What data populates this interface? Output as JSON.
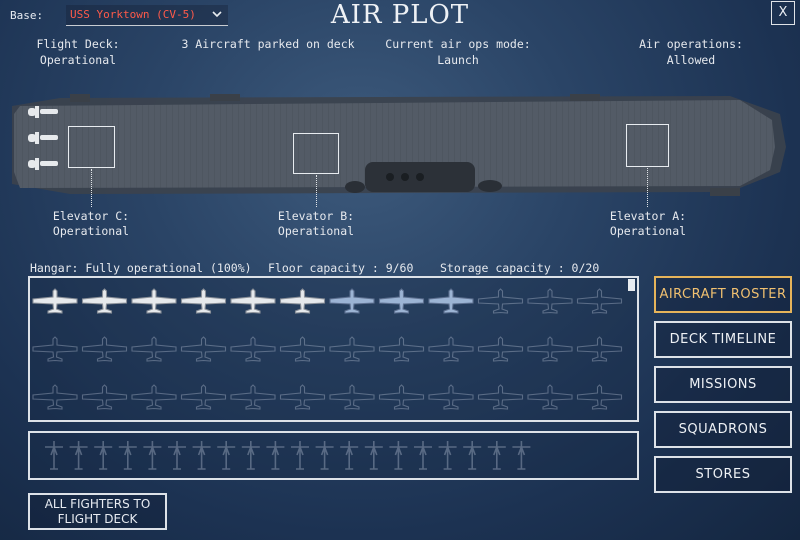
{
  "header": {
    "base_label": "Base:",
    "base_value": "USS Yorktown (CV-5)",
    "title": "AIR PLOT",
    "close_label": "X"
  },
  "status": {
    "flight_deck_label": "Flight Deck:",
    "flight_deck_value": "Operational",
    "parked": "3 Aircraft parked on deck",
    "air_ops_mode_label": "Current air ops mode:",
    "air_ops_mode_value": "Launch",
    "air_operations_label": "Air operations:",
    "air_operations_value": "Allowed"
  },
  "elevators": [
    {
      "label": "Elevator C:",
      "status": "Operational"
    },
    {
      "label": "Elevator B:",
      "status": "Operational"
    },
    {
      "label": "Elevator A:",
      "status": "Operational"
    }
  ],
  "hangar": {
    "status": "Hangar: Fully operational (100%)",
    "floor_capacity": "Floor capacity : 9/60",
    "storage_capacity": "Storage capacity : 0/20",
    "grid_rows": 3,
    "grid_cols": 12,
    "aircraft": [
      "white",
      "white",
      "white",
      "white",
      "white",
      "white",
      "blue",
      "blue",
      "blue"
    ],
    "storage_slots": 20
  },
  "nav": {
    "aircraft_roster": "AIRCRAFT ROSTER",
    "deck_timeline": "DECK TIMELINE",
    "missions": "MISSIONS",
    "squadrons": "SQUADRONS",
    "stores": "STORES"
  },
  "actions": {
    "all_fighters_line1": "ALL FIGHTERS TO",
    "all_fighters_line2": "FLIGHT DECK"
  },
  "colors": {
    "accent_active": "#e6b45a",
    "base_value": "#ff5a4a",
    "plane_white": "#e6e9ec",
    "plane_blue": "#9cb4d4"
  },
  "icons": {
    "plane": "plane-icon",
    "dropdown": "chevron-down-icon",
    "close": "close-icon"
  }
}
